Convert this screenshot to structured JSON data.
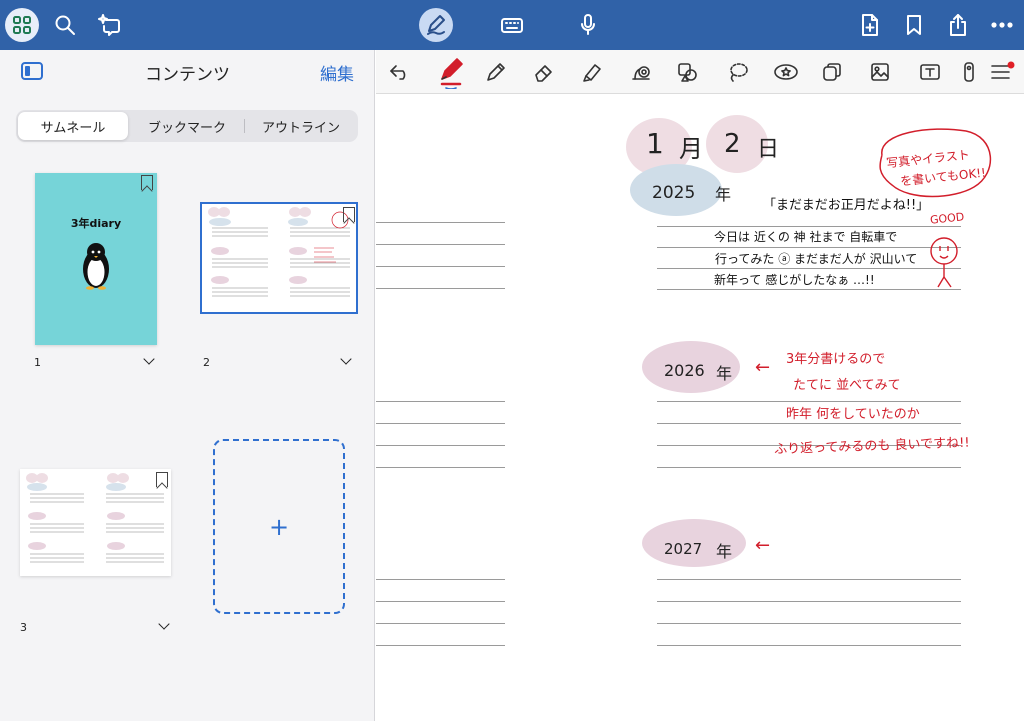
{
  "sidebar": {
    "title": "コンテンツ",
    "edit_label": "編集",
    "tabs": [
      {
        "label": "サムネール",
        "active": true
      },
      {
        "label": "ブックマーク",
        "active": false
      },
      {
        "label": "アウトライン",
        "active": false
      }
    ],
    "pages": [
      {
        "number": "1",
        "cover_title": "3年diary"
      },
      {
        "number": "2"
      },
      {
        "number": "3"
      }
    ],
    "add_page_symbol": "+"
  },
  "note": {
    "date_month": "1",
    "date_month_unit": "月",
    "date_day": "2",
    "date_day_unit": "日",
    "year1": {
      "year": "2025",
      "unit": "年"
    },
    "year2": {
      "year": "2026",
      "unit": "年"
    },
    "year3": {
      "year": "2027",
      "unit": "年"
    },
    "quote": "「まだまだお正月だよね!!」",
    "entry_line1": "今日は 近くの 神 社まで 自転車で",
    "entry_line2": "行ってみた ⓐ まだまだ人が 沢山いて",
    "entry_line3": "新年って 感じがしたなぁ …!!",
    "good_label": "GOOD",
    "bubble_line1": "写真やイラスト",
    "bubble_line2": "を書いてもOK!!",
    "arrow": "←",
    "memo_line1": "3年分書けるので",
    "memo_line2": "たてに 並べてみて",
    "memo_line3": "昨年 何をしていたのか",
    "memo_line4": "ふり返ってみるのも 良いですね!!"
  },
  "colors": {
    "topbar": "#3062a8",
    "accent": "#2f6fcf",
    "cover": "#76d4d8",
    "blob_pink": "#e7cfd8",
    "blob_blue": "#cfdde8",
    "ink_red": "#d21e2b"
  }
}
